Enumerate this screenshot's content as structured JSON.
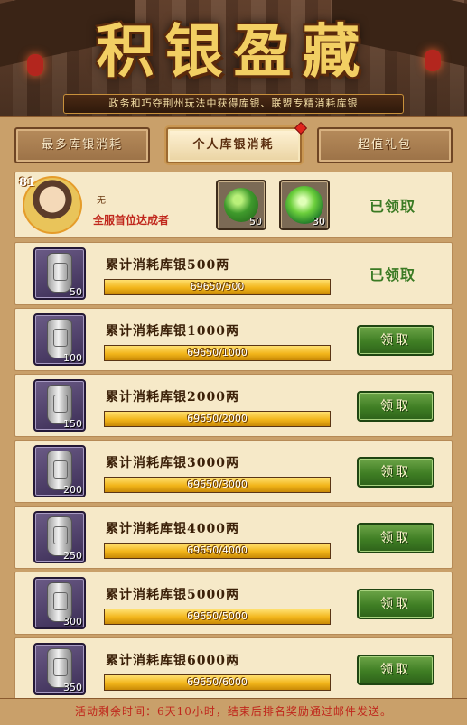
{
  "banner": {
    "title": "积银盈藏",
    "subtitle": "政务和巧夺荆州玩法中获得库银、联盟专精消耗库银"
  },
  "tabs": [
    {
      "label": "最多库银消耗",
      "active": false
    },
    {
      "label": "个人库银消耗",
      "active": true,
      "has_alert": true
    },
    {
      "label": "超值礼包",
      "active": false
    }
  ],
  "first_reward": {
    "level": "81",
    "name": "无",
    "label": "全服首位达成者",
    "items": [
      {
        "icon": "jade-disc-icon",
        "qty": "50"
      },
      {
        "icon": "green-orb-icon",
        "qty": "30"
      }
    ],
    "status": "已领取"
  },
  "rows": [
    {
      "title": "累计消耗库银500两",
      "qty": "50",
      "progress": "69650/500",
      "fill": 1.0,
      "state": "claimed",
      "status": "已领取"
    },
    {
      "title": "累计消耗库银1000两",
      "qty": "100",
      "progress": "69650/1000",
      "fill": 1.0,
      "state": "claim",
      "button": "领取"
    },
    {
      "title": "累计消耗库银2000两",
      "qty": "150",
      "progress": "69650/2000",
      "fill": 1.0,
      "state": "claim",
      "button": "领取"
    },
    {
      "title": "累计消耗库银3000两",
      "qty": "200",
      "progress": "69650/3000",
      "fill": 1.0,
      "state": "claim",
      "button": "领取"
    },
    {
      "title": "累计消耗库银4000两",
      "qty": "250",
      "progress": "69650/4000",
      "fill": 1.0,
      "state": "claim",
      "button": "领取"
    },
    {
      "title": "累计消耗库银5000两",
      "qty": "300",
      "progress": "69650/5000",
      "fill": 1.0,
      "state": "claim",
      "button": "领取"
    },
    {
      "title": "累计消耗库银6000两",
      "qty": "350",
      "progress": "69650/6000",
      "fill": 1.0,
      "state": "claim",
      "button": "领取"
    }
  ],
  "footer": {
    "text": "活动剩余时间：6天10小时，结束后排名奖励通过邮件发送。"
  },
  "colors": {
    "accent_gold": "#f2cf63",
    "claim_green": "#3f7e24",
    "claimed_text": "#3a7a23",
    "alert_red": "#c0271c"
  }
}
